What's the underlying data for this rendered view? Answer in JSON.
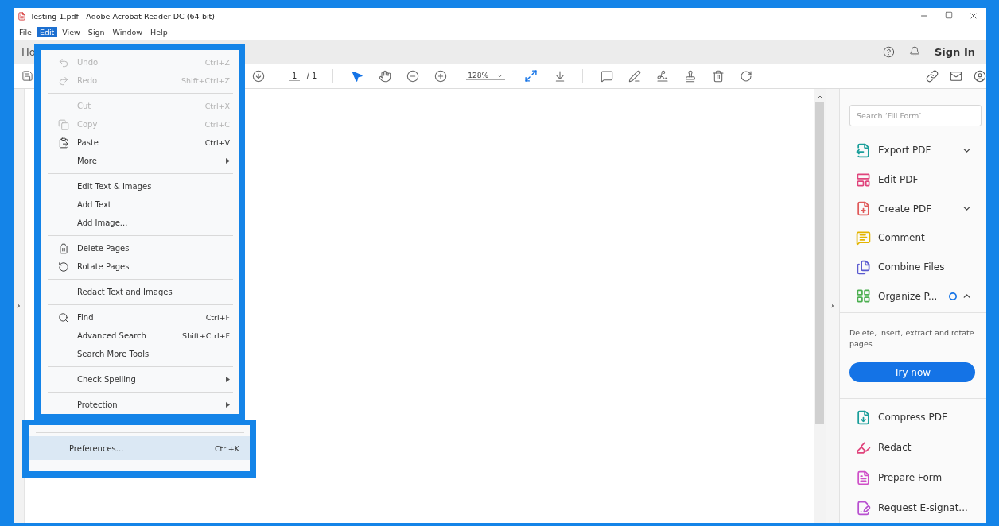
{
  "window": {
    "title": "Testing 1.pdf - Adobe Acrobat Reader DC (64-bit)"
  },
  "menu_bar": [
    {
      "label": "File",
      "selected": false
    },
    {
      "label": "Edit",
      "selected": true
    },
    {
      "label": "View",
      "selected": false
    },
    {
      "label": "Sign",
      "selected": false
    },
    {
      "label": "Window",
      "selected": false
    },
    {
      "label": "Help",
      "selected": false
    }
  ],
  "tabs": [
    {
      "label": "Ho"
    }
  ],
  "header": {
    "sign_in": "Sign In"
  },
  "toolbar": {
    "page_number": "1",
    "page_total": "/ 1",
    "zoom": "128%"
  },
  "edit_menu": {
    "sections": [
      {
        "groups": [
          [
            {
              "label": "Undo",
              "shortcut": "Ctrl+Z",
              "disabled": true,
              "selected": false
            },
            {
              "label": "Redo",
              "shortcut": "Shift+Ctrl+Z",
              "disabled": true,
              "selected": false
            }
          ],
          [
            {
              "label": "Cut",
              "shortcut": "Ctrl+X",
              "disabled": true,
              "selected": false
            },
            {
              "label": "Copy",
              "shortcut": "Ctrl+C",
              "disabled": true,
              "selected": false
            },
            {
              "label": "Paste",
              "shortcut": "Ctrl+V",
              "disabled": false,
              "selected": false
            },
            {
              "label": "More",
              "submenu": true,
              "disabled": false,
              "selected": false
            }
          ],
          [
            {
              "label": "Edit Text & Images",
              "disabled": false,
              "selected": false
            },
            {
              "label": "Add Text",
              "disabled": false,
              "selected": false
            },
            {
              "label": "Add Image...",
              "disabled": false,
              "selected": false
            }
          ],
          [
            {
              "label": "Delete Pages",
              "disabled": false,
              "selected": false
            },
            {
              "label": "Rotate Pages",
              "disabled": false,
              "selected": false
            }
          ],
          [
            {
              "label": "Redact Text and Images",
              "disabled": false,
              "selected": false
            }
          ],
          [
            {
              "label": "Find",
              "shortcut": "Ctrl+F",
              "disabled": false,
              "selected": false
            },
            {
              "label": "Advanced Search",
              "shortcut": "Shift+Ctrl+F",
              "disabled": false,
              "selected": false
            },
            {
              "label": "Search More Tools",
              "disabled": false,
              "selected": false
            }
          ],
          [
            {
              "label": "Check Spelling",
              "submenu": true,
              "disabled": false,
              "selected": false
            }
          ],
          [
            {
              "label": "Protection",
              "submenu": true,
              "disabled": false,
              "selected": false
            }
          ]
        ]
      },
      {
        "groups": [
          [
            {
              "label": "Preferences...",
              "shortcut": "Ctrl+K",
              "disabled": false,
              "selected": true
            }
          ]
        ]
      }
    ]
  },
  "tools_panel": {
    "search": {
      "placeholder": "Search ‘Fill Form’"
    },
    "tools": [
      {
        "label": "Export PDF",
        "color": "#1a9e9a",
        "expanded": false
      },
      {
        "label": "Edit PDF",
        "color": "#e0447c"
      },
      {
        "label": "Create PDF",
        "color": "#e05a5a",
        "expanded": false
      },
      {
        "label": "Comment",
        "color": "#e3b400"
      },
      {
        "label": "Combine Files",
        "color": "#5a5ad0"
      },
      {
        "label": "Organize P...",
        "color": "#4caf50",
        "expanded": true,
        "notice": true
      }
    ],
    "details": {
      "description": "Delete, insert, extract and rotate pages.",
      "button": "Try now"
    },
    "more_tools": [
      {
        "label": "Compress PDF",
        "color": "#1a9e9a"
      },
      {
        "label": "Redact",
        "color": "#e0447c"
      },
      {
        "label": "Prepare Form",
        "color": "#cf4fc8"
      },
      {
        "label": "Request E-signat...",
        "color": "#b84fd0"
      }
    ]
  }
}
